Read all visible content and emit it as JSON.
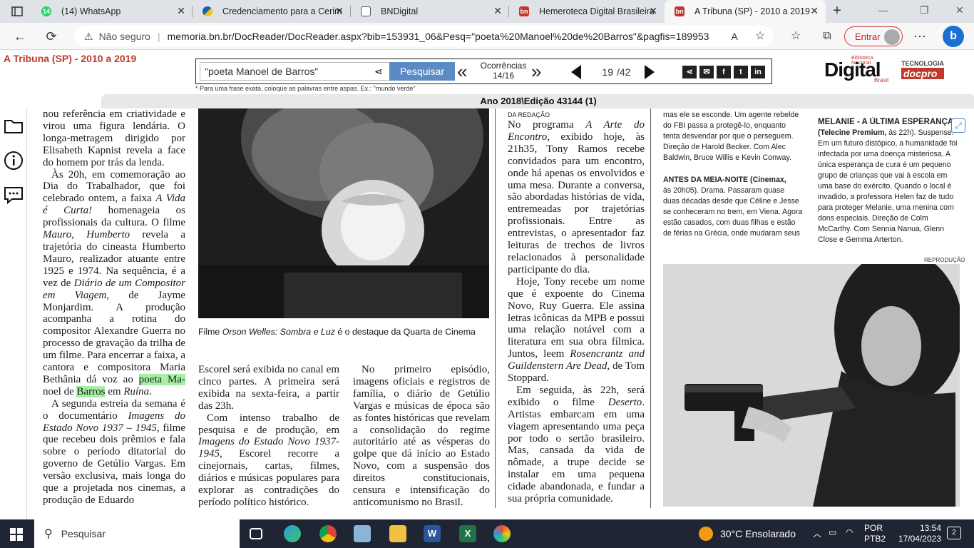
{
  "browser": {
    "tabs": [
      {
        "label": "(14) WhatsApp",
        "icon": "whatsapp-icon",
        "color": "#25d366",
        "glyph": "14"
      },
      {
        "label": "Credenciamento para a Cerim",
        "icon": "gov-br-icon",
        "color": "#1a5bb5",
        "glyph": ""
      },
      {
        "label": "BNDigital",
        "icon": "document-icon",
        "color": "#666666",
        "glyph": ""
      },
      {
        "label": "Hemeroteca Digital Brasileira",
        "icon": "hemeroteca-icon",
        "color": "#c0392b",
        "glyph": "bn"
      },
      {
        "label": "A Tribuna (SP) - 2010 a 2019",
        "icon": "hemeroteca-icon",
        "color": "#c0392b",
        "glyph": "bn"
      }
    ],
    "address": {
      "security": "Não seguro",
      "url": "memoria.bn.br/DocReader/DocReader.aspx?bib=153931_06&Pesq=\"poeta%20Manoel%20de%20Barros\"&pagfis=189953"
    },
    "signin_label": "Entrar"
  },
  "viewer": {
    "publication": "A Tribuna (SP) - 2010 a 2019",
    "search_value": "\"poeta Manoel de Barros\"",
    "search_button": "Pesquisar",
    "occurrences_label": "Ocorrências",
    "occurrences_value": "14/16",
    "page_current": "19",
    "page_total": "/42",
    "hint": "* Para uma frase exata, coloque as palavras entre aspas. Ex.: \"mundo verde\"",
    "logo_text": "Digital",
    "logo_small": "Biblioteca Nacional",
    "logo_brasil": "Brasil",
    "tech_label": "TECNOLOGIA",
    "tech_brand": "docpro",
    "edition": "Ano 2018\\Edição 43144 (1)"
  },
  "article": {
    "col1": {
      "p1": "nou referência em criatividade e virou uma figura lendária. O longa-metragem dirigido por Elisabeth Kapnist revela a face do homem por trás da lenda.",
      "p2a": "Às 20h, em comemoração ao Dia do Trabalhador, que foi celebrado ontem, a faixa ",
      "p2i": "A Vida é Curta!",
      "p2b": " homenageia os profissionais da cultura. O filme ",
      "p2i2": "Mauro, Humberto",
      "p2c": " revela a trajetória do cineasta Humberto Mauro, realizador atuante entre 1925 e 1974. Na sequência, é a vez de ",
      "p2i3": "Diário de um Compositor em Viagem",
      "p2d": ", de Jayme Monjardim. A produção acompanha a rotina do compositor Alexandre Guerra no processo de gravação da trilha de um filme. Para encerrar a faixa, a cantora e compositora Maria Bethânia dá voz ao ",
      "hl1": "poeta Ma-",
      "p2e": " noel de ",
      "hl2": "Barros",
      "p2f": " em ",
      "p2i4": "Ruína",
      "p2g": ".",
      "p3a": "A segunda estreia da semana é o documentário ",
      "p3i": "Imagens do Estado Novo 1937 – 1945",
      "p3b": ", filme que recebeu dois prêmios e fala sobre o período ditatorial do governo de Getúlio Vargas. Em versão exclusiva, mais longa do que a projetada nos cinemas, a produção de Eduardo"
    },
    "caption_a": "Filme ",
    "caption_i": "Orson Welles: Sombra e Luz",
    "caption_b": " é o destaque da Quarta de Cinema",
    "col2": "Escorel será exibida no canal em cinco partes. A primeira será exibida na sexta-feira, a partir das 23h.",
    "col2b_a": "Com intenso trabalho de pesquisa e de produção, em ",
    "col2b_i": "Imagens do Estado Novo 1937-1945",
    "col2b_b": ", Escorel recorre a cinejornais, cartas, filmes, diários e músicas populares para explorar as contradições do período político histórico.",
    "col3": "No primeiro episódio, imagens oficiais e registros de família, o diário de Getúlio Vargas e músicas de época são as fontes históricas que revelam a consolidação do regime autoritário até as vésperas do golpe que dá início ao Estado Novo, com a suspensão dos direitos constitucionais, censura e intensificação do anticomunismo no Brasil.",
    "col4": {
      "byline": "DA REDAÇÃO",
      "p1a": "No programa ",
      "p1i": "A Arte do Encontro",
      "p1b": ", exibido hoje, às 21h35, Tony Ramos recebe convidados para um encontro, onde há apenas os envolvidos e uma mesa. Durante a conversa, são abordadas histórias de vida, entremeadas por trajetórias profissionais. Entre as entrevistas, o apresentador faz leituras de trechos de livros relacionados à personalidade participante do dia.",
      "p2a": "Hoje, Tony recebe um nome que é expoente do Cinema Novo, Ruy Guerra. Ele assina letras icônicas da MPB e possui uma relação notável com a literatura em sua obra fílmica. Juntos, leem ",
      "p2i": "Rosencrantz and Guildenstern Are Dead",
      "p2b": ", de Tom Stoppard.",
      "p3a": "Em seguida, às 22h, será exibido o filme ",
      "p3i": "Deserto",
      "p3b": ". Artistas embarcam em uma viagem apresentando uma peça por todo o sertão brasileiro. Mas, cansada da vida de nômade, a trupe decide se instalar em uma pequena cidade abandonada, e fundar a sua própria comunidade."
    },
    "col5": {
      "top": "mas ele se esconde. Um agente rebelde do FBI passa a protegê-lo, enquanto tenta desvendar por que o perseguem. Direção de Harold Becker. Com Alec Baldwin, Bruce Willis e Kevin Conway.",
      "h2": "ANTES DA MEIA-NOITE",
      "h2ch": " (Cinemax,",
      "p2": "às 20h05). Drama. Passaram quase duas décadas desde que Céline e Jesse se conheceram no trem, em Viena. Agora estão casados, com duas filhas e estão de férias na Grécia, onde mudaram seus"
    },
    "col6": {
      "h1": "MELANIE - A ÚLTIMA ESPERANÇA",
      "ch": "(Telecine Premium,",
      "p1a": " às 22h). Suspense. Em um futuro distópico, a humanidade foi infectada por uma doença misteriosa. A única esperança de cura é um pequeno grupo de crianças que vai à escola em uma base do exército. Quando o local é invadido, a professora Helen faz de tudo para proteger Melanie, uma menina com dons especiais. Direção de Colm McCarthy. Com Sennia Nanua, Glenn Close e Gemma Arterton."
    },
    "photo_credit": "REPRODUÇÃO"
  },
  "taskbar": {
    "search_label": "Pesquisar",
    "weather": "30°C  Ensolarado",
    "lang1": "POR",
    "lang2": "PTB2",
    "time": "13:54",
    "date": "17/04/2023",
    "notif": "2"
  }
}
